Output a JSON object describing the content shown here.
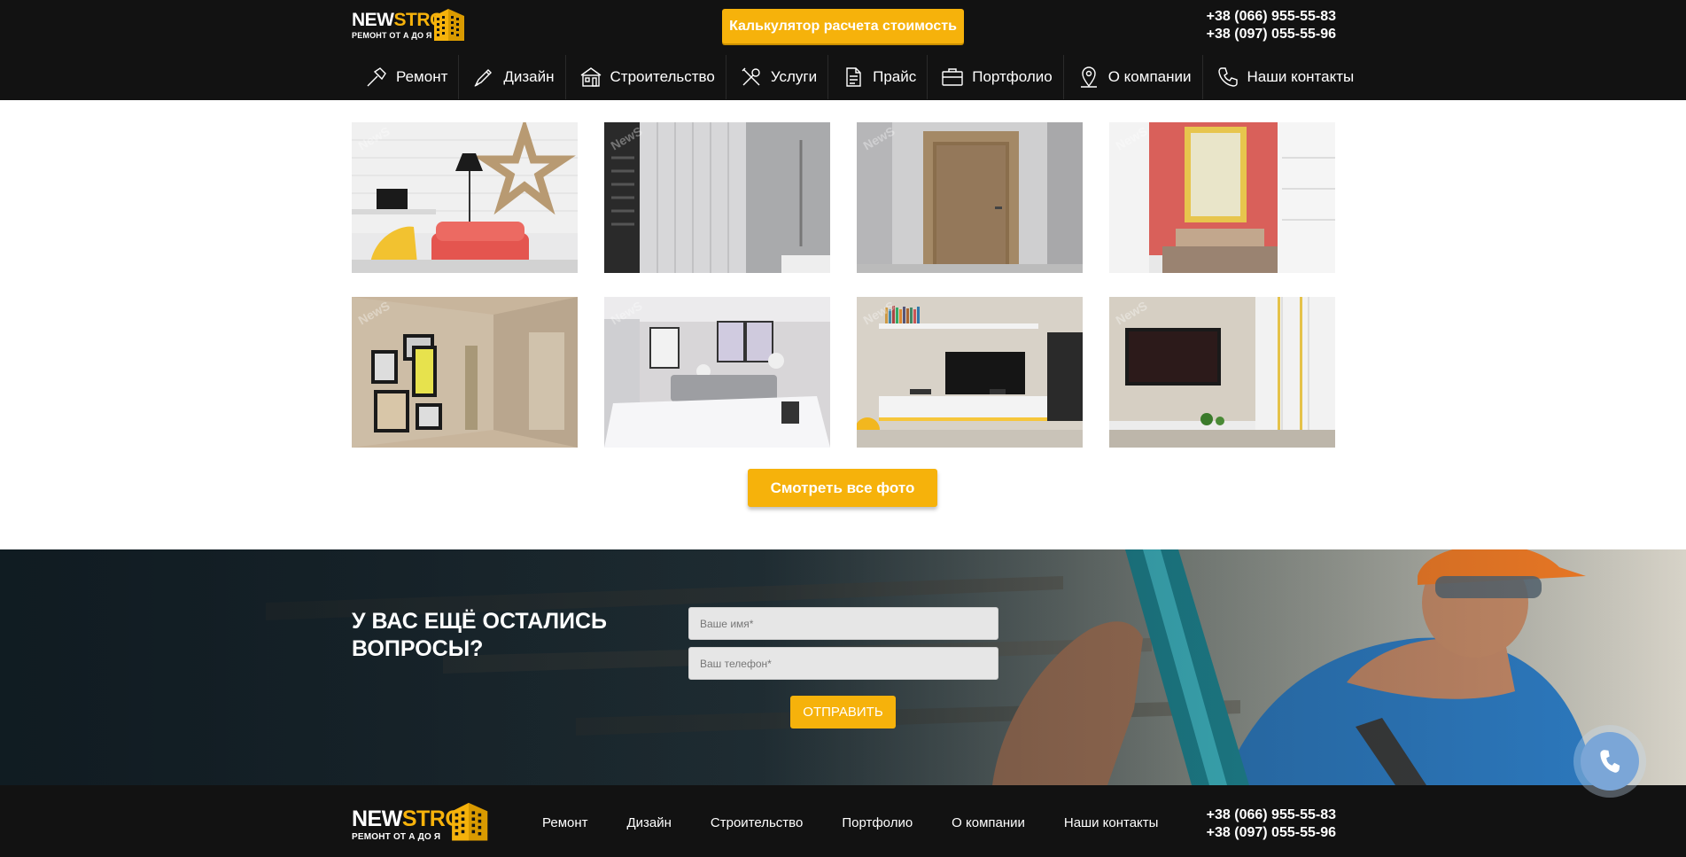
{
  "brand": {
    "name_white": "NEW",
    "name_yellow": "STROY",
    "tagline": "РЕМОНТ ОТ А ДО Я",
    "accent": "#f6b20b",
    "dark": "#121212"
  },
  "header": {
    "calc_button": "Калькулятор расчета стоимость",
    "phone_1": "+38 (066) 955-55-83",
    "phone_2": "+38 (097) 055-55-96"
  },
  "nav": {
    "items": [
      {
        "label": "Ремонт",
        "icon": "hammer-icon"
      },
      {
        "label": "Дизайн",
        "icon": "pencil-brush-icon"
      },
      {
        "label": "Строительство",
        "icon": "house-icon"
      },
      {
        "label": "Услуги",
        "icon": "tools-icon"
      },
      {
        "label": "Прайс",
        "icon": "document-icon"
      },
      {
        "label": "Портфолио",
        "icon": "briefcase-icon"
      },
      {
        "label": "О компании",
        "icon": "map-pin-icon"
      },
      {
        "label": "Наши контакты",
        "icon": "phone-icon"
      }
    ]
  },
  "gallery": {
    "photos": [
      {
        "scene": "living-room-star-lamp"
      },
      {
        "scene": "bathroom-radiator"
      },
      {
        "scene": "wooden-door"
      },
      {
        "scene": "bedroom-red-wall-poster"
      },
      {
        "scene": "hallway-picture-frames"
      },
      {
        "scene": "bedroom-gray-headboard"
      },
      {
        "scene": "tv-wall-bookshelf"
      },
      {
        "scene": "tv-wall-white-cabinets"
      }
    ],
    "watermark": "NewS",
    "view_all_button": "Смотреть все фото"
  },
  "questions": {
    "title_line1": "У ВАС ЕЩЁ ОСТАЛИСЬ",
    "title_line2": "ВОПРОСЫ?",
    "name_placeholder": "Ваше имя*",
    "phone_placeholder": "Ваш телефон*",
    "send_button": "ОТПРАВИТЬ"
  },
  "footer": {
    "nav": [
      "Ремонт",
      "Дизайн",
      "Строительство",
      "Портфолио",
      "О компании",
      "Наши контакты"
    ],
    "phone_1": "+38 (066) 955-55-83",
    "phone_2": "+38 (097) 055-55-96"
  },
  "floating_call": {
    "icon": "phone-icon",
    "color": "#7ba6d7"
  }
}
